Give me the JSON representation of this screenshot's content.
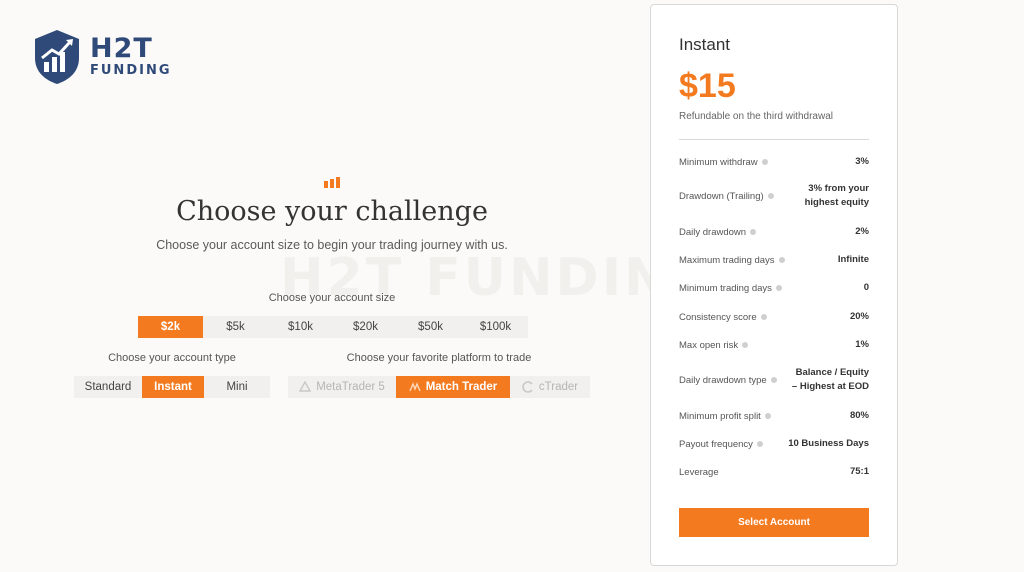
{
  "brand": {
    "name": "H2T",
    "sub": "FUNDING",
    "watermark": "H2T FUNDING",
    "accent": "#f47a1f",
    "navy": "#2f4a78"
  },
  "hero": {
    "title": "Choose your challenge",
    "subtitle": "Choose your account size to begin your trading journey with us."
  },
  "account_size": {
    "label": "Choose your account size",
    "options": [
      "$2k",
      "$5k",
      "$10k",
      "$20k",
      "$50k",
      "$100k"
    ],
    "selected": "$2k"
  },
  "account_type": {
    "label": "Choose your account type",
    "options": [
      "Standard",
      "Instant",
      "Mini"
    ],
    "selected": "Instant"
  },
  "platform": {
    "label": "Choose your favorite platform to trade",
    "options": [
      {
        "label": "MetaTrader 5",
        "icon": "metatrader-icon"
      },
      {
        "label": "Match Trader",
        "icon": "match-trader-icon"
      },
      {
        "label": "cTrader",
        "icon": "ctrader-icon"
      }
    ],
    "selected": "Match Trader"
  },
  "card": {
    "title": "Instant",
    "price": "$15",
    "note": "Refundable on the third withdrawal",
    "stats": [
      {
        "label": "Minimum withdraw",
        "value": "3%"
      },
      {
        "label": "Drawdown (Trailing)",
        "value": "3% from your highest equity"
      },
      {
        "label": "Daily drawdown",
        "value": "2%"
      },
      {
        "label": "Maximum trading days",
        "value": "Infinite"
      },
      {
        "label": "Minimum trading days",
        "value": "0"
      },
      {
        "label": "Consistency score",
        "value": "20%"
      },
      {
        "label": "Max open risk",
        "value": "1%"
      },
      {
        "label": "Daily drawdown type",
        "value": "Balance / Equity – Highest at EOD"
      },
      {
        "label": "Minimum profit split",
        "value": "80%"
      },
      {
        "label": "Payout frequency",
        "value": "10 Business Days"
      },
      {
        "label": "Leverage",
        "value": "75:1"
      }
    ],
    "button": "Select Account"
  }
}
